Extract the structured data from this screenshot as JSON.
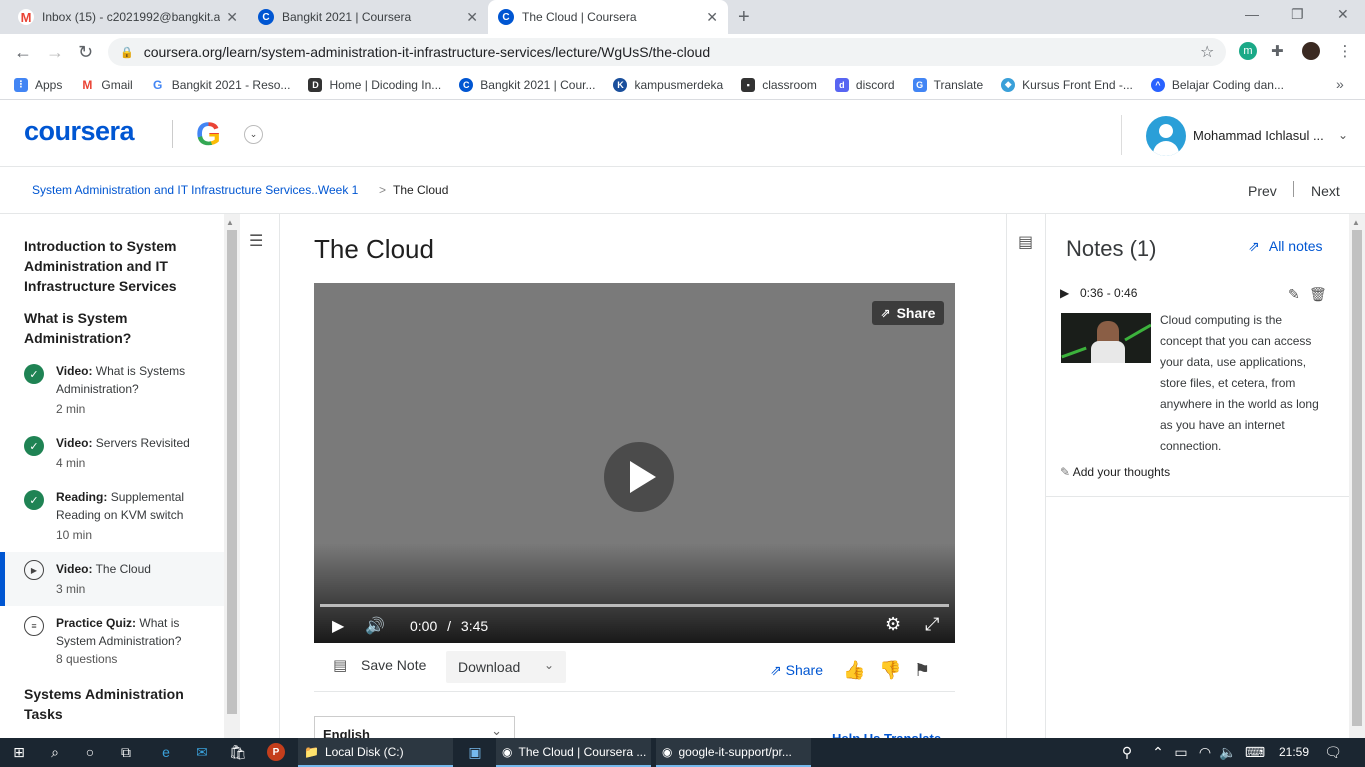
{
  "browser": {
    "tabs": [
      {
        "title": "Inbox (15) - c2021992@bangkit.ac",
        "icon": "gmail-icon",
        "active": false
      },
      {
        "title": "Bangkit 2021 | Coursera",
        "icon": "coursera-icon",
        "active": false
      },
      {
        "title": "The Cloud | Coursera",
        "icon": "coursera-icon",
        "active": true
      }
    ],
    "url": "coursera.org/learn/system-administration-it-infrastructure-services/lecture/WgUsS/the-cloud",
    "bookmarks": [
      {
        "label": "Apps",
        "color": "#4285f4"
      },
      {
        "label": "Gmail",
        "color": "#ea4335"
      },
      {
        "label": "Bangkit 2021 - Reso...",
        "color": "#fbbc05"
      },
      {
        "label": "Home | Dicoding In...",
        "color": "#333333"
      },
      {
        "label": "Bangkit 2021 | Cour...",
        "color": "#0056d2"
      },
      {
        "label": "kampusmerdeka",
        "color": "#1a4f9c"
      },
      {
        "label": "classroom",
        "color": "#333333"
      },
      {
        "label": "discord",
        "color": "#5865f2"
      },
      {
        "label": "Translate",
        "color": "#4285f4"
      },
      {
        "label": "Kursus Front End -...",
        "color": "#3aa0d9"
      },
      {
        "label": "Belajar Coding dan...",
        "color": "#2962ff"
      }
    ]
  },
  "header": {
    "logo": "coursera",
    "partner_logo": "G",
    "username": "Mohammad Ichlasul ..."
  },
  "breadcrumb": {
    "course": "System Administration and IT Infrastructure Services..Week 1",
    "separator": ">",
    "current": "The Cloud",
    "prev": "Prev",
    "next": "Next"
  },
  "sidebar": {
    "course_title": "Introduction to System Administration and IT Infrastructure Services",
    "section_title": "What is System Administration?",
    "items": [
      {
        "type": "Video:",
        "title": "What is Systems Administration?",
        "duration": "2 min",
        "status": "completed"
      },
      {
        "type": "Video:",
        "title": "Servers Revisited",
        "duration": "4 min",
        "status": "completed"
      },
      {
        "type": "Reading:",
        "title": "Supplemental Reading on KVM switch",
        "duration": "10 min",
        "status": "completed"
      },
      {
        "type": "Video:",
        "title": "The Cloud",
        "duration": "3 min",
        "status": "current"
      },
      {
        "type": "Practice Quiz:",
        "title": "What is System Administration?",
        "duration": "8 questions",
        "status": "todo"
      }
    ],
    "next_section_title": "Systems Administration Tasks"
  },
  "main": {
    "title": "The Cloud",
    "video": {
      "share_label": "Share",
      "current_time": "0:00",
      "time_separator": "/",
      "total_time": "3:45",
      "progress": 0
    },
    "actions": {
      "save_note": "Save Note",
      "download": "Download",
      "share": "Share"
    },
    "language": "English",
    "help_translate": "Help Us Translate"
  },
  "notes": {
    "title": "Notes (1)",
    "all_notes": "All notes",
    "items": [
      {
        "time_range": "0:36 - 0:46",
        "text": "Cloud computing is the concept that you can access your data, use applications, store files, et cetera, from anywhere in the world as long as you have an internet connection."
      }
    ],
    "add_thoughts": "Add your thoughts"
  },
  "taskbar": {
    "items": [
      {
        "label": "Local Disk (C:)"
      },
      {
        "label": "The Cloud | Coursera ..."
      },
      {
        "label": "google-it-support/pr..."
      }
    ],
    "time": "21:59"
  },
  "colors": {
    "brand": "#0056d2",
    "completed": "#1f8354",
    "taskbar": "#1b2631"
  }
}
